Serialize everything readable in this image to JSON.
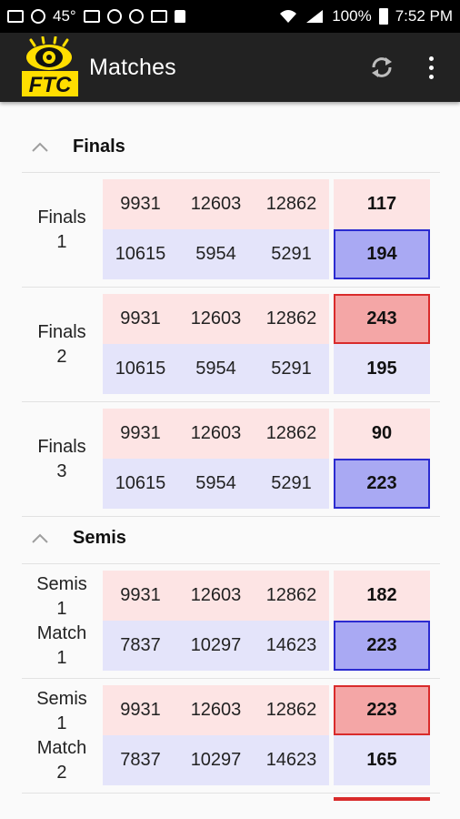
{
  "status_bar": {
    "temperature": "45°",
    "battery": "100%",
    "time": "7:52 PM"
  },
  "app_bar": {
    "title": "Matches",
    "logo_text": "FTC"
  },
  "colors": {
    "red_alliance_bg": "#fde4e4",
    "blue_alliance_bg": "#e4e4fa",
    "red_win_bg": "#f4a6a6",
    "red_win_border": "#d92b2b",
    "blue_win_bg": "#a9a9f3",
    "blue_win_border": "#2b2bd0",
    "logo_yellow": "#ffde00"
  },
  "sections": [
    {
      "title": "Finals",
      "matches": [
        {
          "label": [
            "Finals",
            "1"
          ],
          "red": {
            "teams": [
              "9931",
              "12603",
              "12862"
            ],
            "score": "117",
            "win": false
          },
          "blue": {
            "teams": [
              "10615",
              "5954",
              "5291"
            ],
            "score": "194",
            "win": true
          }
        },
        {
          "label": [
            "Finals",
            "2"
          ],
          "red": {
            "teams": [
              "9931",
              "12603",
              "12862"
            ],
            "score": "243",
            "win": true
          },
          "blue": {
            "teams": [
              "10615",
              "5954",
              "5291"
            ],
            "score": "195",
            "win": false
          }
        },
        {
          "label": [
            "Finals",
            "3"
          ],
          "red": {
            "teams": [
              "9931",
              "12603",
              "12862"
            ],
            "score": "90",
            "win": false
          },
          "blue": {
            "teams": [
              "10615",
              "5954",
              "5291"
            ],
            "score": "223",
            "win": true
          }
        }
      ]
    },
    {
      "title": "Semis",
      "matches": [
        {
          "label": [
            "Semis",
            "1",
            "Match",
            "1"
          ],
          "red": {
            "teams": [
              "9931",
              "12603",
              "12862"
            ],
            "score": "182",
            "win": false
          },
          "blue": {
            "teams": [
              "7837",
              "10297",
              "14623"
            ],
            "score": "223",
            "win": true
          }
        },
        {
          "label": [
            "Semis",
            "1",
            "Match",
            "2"
          ],
          "red": {
            "teams": [
              "9931",
              "12603",
              "12862"
            ],
            "score": "223",
            "win": true
          },
          "blue": {
            "teams": [
              "7837",
              "10297",
              "14623"
            ],
            "score": "165",
            "win": false
          }
        }
      ]
    }
  ]
}
